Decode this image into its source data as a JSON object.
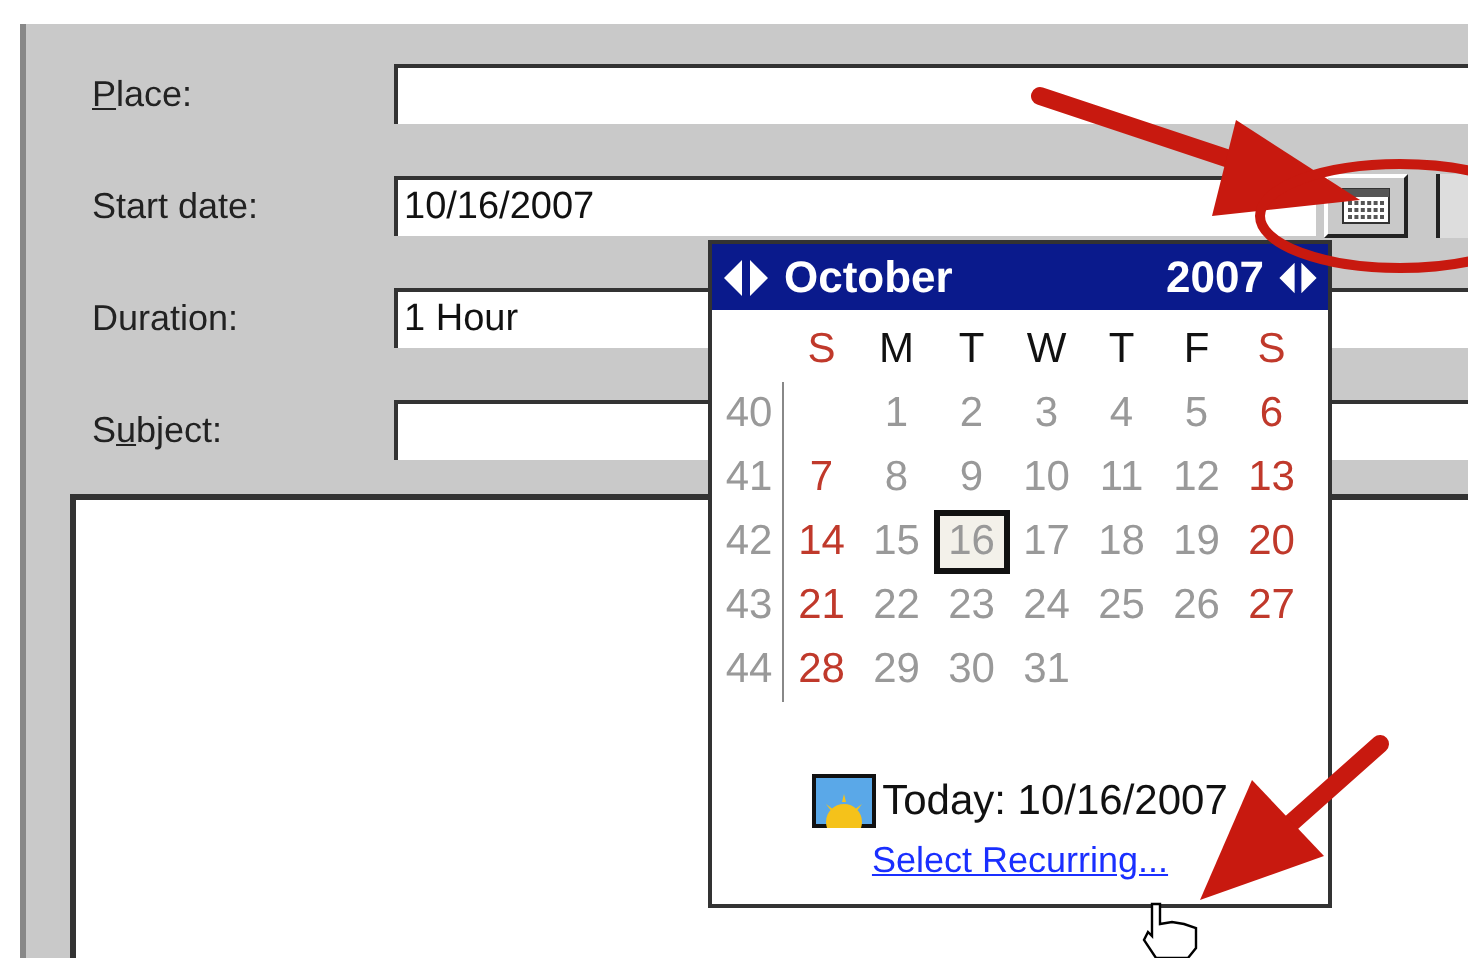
{
  "form": {
    "fields": [
      {
        "label": [
          {
            "text": "P",
            "underlined": true
          },
          {
            "text": "lace:",
            "underlined": false
          }
        ],
        "kind": "text"
      },
      {
        "label": [
          {
            "text": "Start date:",
            "underlined": false
          }
        ],
        "value": "10/16/2007",
        "kind": "date"
      },
      {
        "label": [
          {
            "text": "Duration:",
            "underlined": false
          }
        ],
        "value": "1 Hour",
        "kind": "text"
      },
      {
        "label": [
          {
            "text": "S",
            "underlined": false
          },
          {
            "text": "u",
            "underlined": true
          },
          {
            "text": "bject:",
            "underlined": false
          }
        ],
        "kind": "text"
      }
    ]
  },
  "calendar": {
    "month": "October",
    "year": "2007",
    "weekdays": [
      {
        "label": "S",
        "weekend": true
      },
      {
        "label": "M",
        "weekend": false
      },
      {
        "label": "T",
        "weekend": false
      },
      {
        "label": "W",
        "weekend": false
      },
      {
        "label": "T",
        "weekend": false
      },
      {
        "label": "F",
        "weekend": false
      },
      {
        "label": "S",
        "weekend": true
      }
    ],
    "weeks": [
      {
        "week": "40",
        "days": [
          {
            "day": "1",
            "weekend": false,
            "selected": false
          },
          {
            "day": "2",
            "weekend": false,
            "selected": false
          },
          {
            "day": "3",
            "weekend": false,
            "selected": false
          },
          {
            "day": "4",
            "weekend": false,
            "selected": false
          },
          {
            "day": "5",
            "weekend": false,
            "selected": false
          },
          {
            "day": "6",
            "weekend": true,
            "selected": false
          }
        ]
      },
      {
        "week": "41",
        "days": [
          {
            "day": "7",
            "weekend": true,
            "selected": false
          },
          {
            "day": "8",
            "weekend": false,
            "selected": false
          },
          {
            "day": "9",
            "weekend": false,
            "selected": false
          },
          {
            "day": "10",
            "weekend": false,
            "selected": false
          },
          {
            "day": "11",
            "weekend": false,
            "selected": false
          },
          {
            "day": "12",
            "weekend": false,
            "selected": false
          },
          {
            "day": "13",
            "weekend": true,
            "selected": false
          }
        ]
      },
      {
        "week": "42",
        "days": [
          {
            "day": "14",
            "weekend": true,
            "selected": false
          },
          {
            "day": "15",
            "weekend": false,
            "selected": false
          },
          {
            "day": "16",
            "weekend": false,
            "selected": true
          },
          {
            "day": "17",
            "weekend": false,
            "selected": false
          },
          {
            "day": "18",
            "weekend": false,
            "selected": false
          },
          {
            "day": "19",
            "weekend": false,
            "selected": false
          },
          {
            "day": "20",
            "weekend": true,
            "selected": false
          }
        ]
      },
      {
        "week": "43",
        "days": [
          {
            "day": "21",
            "weekend": true,
            "selected": false
          },
          {
            "day": "22",
            "weekend": false,
            "selected": false
          },
          {
            "day": "23",
            "weekend": false,
            "selected": false
          },
          {
            "day": "24",
            "weekend": false,
            "selected": false
          },
          {
            "day": "25",
            "weekend": false,
            "selected": false
          },
          {
            "day": "26",
            "weekend": false,
            "selected": false
          },
          {
            "day": "27",
            "weekend": true,
            "selected": false
          }
        ]
      },
      {
        "week": "44",
        "days": [
          {
            "day": "28",
            "weekend": true,
            "selected": false
          },
          {
            "day": "29",
            "weekend": false,
            "selected": false
          },
          {
            "day": "30",
            "weekend": false,
            "selected": false
          },
          {
            "day": "31",
            "weekend": false,
            "selected": false
          }
        ]
      }
    ],
    "today": "Today: 10/16/2007",
    "link": "Select Recurring..."
  }
}
